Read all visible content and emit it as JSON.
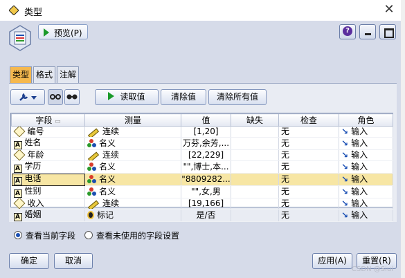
{
  "window": {
    "title": "类型",
    "close_glyph": "✕"
  },
  "header": {
    "preview_label": "预览(P)",
    "help_glyph": "?"
  },
  "tabs": [
    {
      "label": "类型",
      "active": true
    },
    {
      "label": "格式",
      "active": false
    },
    {
      "label": "注解",
      "active": false
    }
  ],
  "toolbar": {
    "read_values": "读取值",
    "clear_values": "清除值",
    "clear_all_values": "清除所有值"
  },
  "grid": {
    "columns": [
      "字段",
      "测量",
      "值",
      "缺失",
      "检查",
      "角色"
    ],
    "rows": [
      {
        "field": "编号",
        "ftype": "diamond",
        "measure": "连续",
        "mtype": "ruler",
        "value": "[1,20]",
        "missing": "",
        "check": "无",
        "role": "输入",
        "selected": false
      },
      {
        "field": "姓名",
        "ftype": "A",
        "measure": "名义",
        "mtype": "dots",
        "value": "万芬,余芳,...",
        "missing": "",
        "check": "无",
        "role": "输入",
        "selected": false
      },
      {
        "field": "年龄",
        "ftype": "diamond",
        "measure": "连续",
        "mtype": "ruler",
        "value": "[22,229]",
        "missing": "",
        "check": "无",
        "role": "输入",
        "selected": false
      },
      {
        "field": "学历",
        "ftype": "A",
        "measure": "名义",
        "mtype": "dots",
        "value": "\"\",博士,本...",
        "missing": "",
        "check": "无",
        "role": "输入",
        "selected": false
      },
      {
        "field": "电话",
        "ftype": "A",
        "measure": "名义",
        "mtype": "dots",
        "value": "\"8809282...",
        "missing": "",
        "check": "无",
        "role": "输入",
        "selected": true
      },
      {
        "field": "性别",
        "ftype": "A",
        "measure": "名义",
        "mtype": "dots",
        "value": "\"\",女,男",
        "missing": "",
        "check": "无",
        "role": "输入",
        "selected": false
      },
      {
        "field": "收入",
        "ftype": "diamond",
        "measure": "连续",
        "mtype": "ruler",
        "value": "[19,166]",
        "missing": "",
        "check": "无",
        "role": "输入",
        "selected": false
      },
      {
        "field": "婚姻",
        "ftype": "A",
        "measure": "标记",
        "mtype": "flag",
        "value": "是/否",
        "missing": "",
        "check": "无",
        "role": "输入",
        "selected": false
      }
    ]
  },
  "options": {
    "show_current": "查看当前字段",
    "show_unused": "查看未使用的字段设置",
    "selected": "show_current"
  },
  "footer": {
    "ok": "确定",
    "cancel": "取消",
    "apply": "应用(A)",
    "reset": "重置(R)"
  },
  "watermark": "CSDN @Siui"
}
